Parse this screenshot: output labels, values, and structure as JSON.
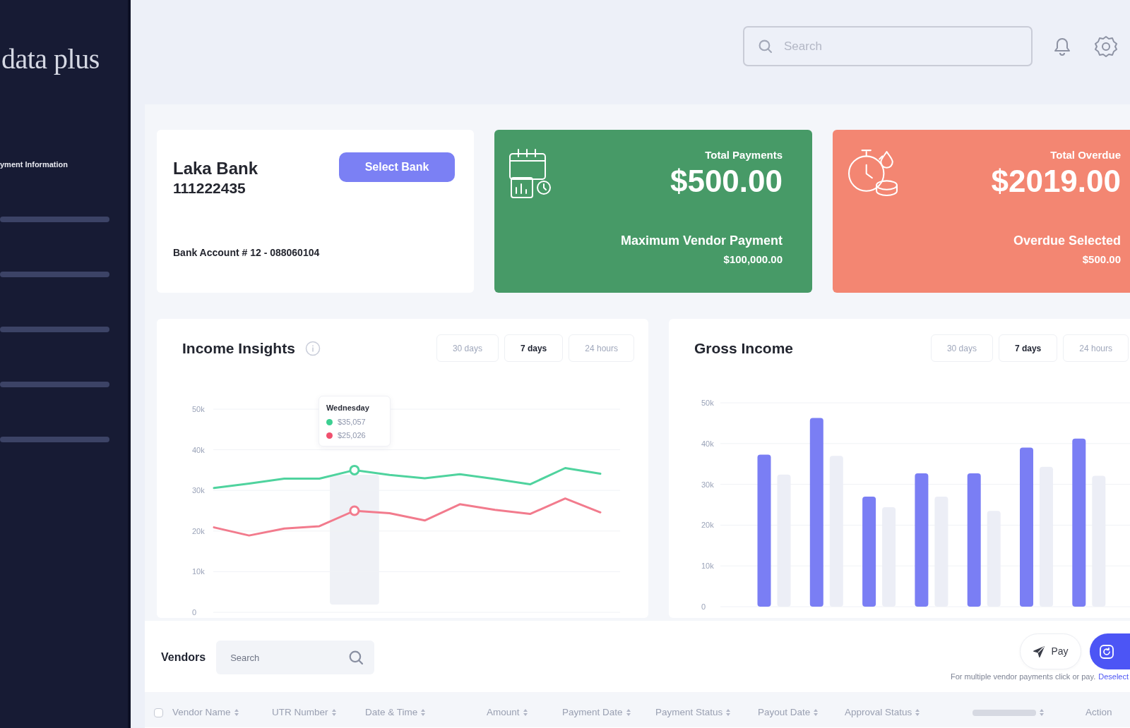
{
  "sidebar": {
    "logo": "data plus",
    "items": [
      {
        "kind": "link",
        "label": "yment Information"
      },
      {
        "kind": "skeleton"
      },
      {
        "kind": "skeleton"
      },
      {
        "kind": "skeleton"
      },
      {
        "kind": "skeleton"
      },
      {
        "kind": "skeleton"
      }
    ]
  },
  "header": {
    "search": {
      "placeholder": "Search"
    }
  },
  "bank_card": {
    "name": "Laka Bank",
    "number": "111222435",
    "button": "Select Bank",
    "account": "Bank Account # 12 - 088060104"
  },
  "stat_cards": [
    {
      "kind": "payments",
      "title": "Total Payments",
      "amount": "$500.00",
      "caption": "Maximum Vendor Payment",
      "caption_value": "$100,000.00",
      "color": "#479a67"
    },
    {
      "kind": "overdue",
      "title": "Total Overdue",
      "amount": "$2019.00",
      "caption": "Overdue Selected",
      "caption_value": "$500.00",
      "color": "#f38672"
    }
  ],
  "income_insights": {
    "title": "Income Insights",
    "range_tabs": [
      {
        "label": "30 days",
        "selected": false
      },
      {
        "label": "7 days",
        "selected": true
      },
      {
        "label": "24 hours",
        "selected": false
      }
    ],
    "tooltip": {
      "title": "Wednesday",
      "entries": [
        {
          "color": "#3ccf91",
          "value": "$35,057"
        },
        {
          "color": "#f0506e",
          "value": "$25,026"
        }
      ]
    },
    "chart_data": [
      {
        "type": "line",
        "categories": [
          null,
          null,
          null,
          null,
          null,
          null,
          null,
          null,
          null,
          null,
          null,
          null
        ],
        "series": [
          {
            "color": "#4fd39e",
            "values": [
              30600,
              31700,
              32900,
              32900,
              35000,
              33800,
              33000,
              34000,
              32800,
              31500,
              35500,
              34100
            ]
          },
          {
            "color": "#f27b8d",
            "values": [
              20900,
              18900,
              20600,
              21200,
              25000,
              24400,
              22600,
              26600,
              25200,
              24200,
              28000,
              24600
            ]
          }
        ],
        "ylim": [
          0,
          50000
        ],
        "yticks": [
          {
            "value": 0,
            "label": "0"
          },
          {
            "value": 10000,
            "label": "10k"
          },
          {
            "value": 20000,
            "label": "20k"
          },
          {
            "value": 30000,
            "label": "30k"
          },
          {
            "value": 40000,
            "label": "40k"
          },
          {
            "value": 50000,
            "label": "50k"
          }
        ],
        "grid": true
      }
    ]
  },
  "gross_income": {
    "title": "Gross Income",
    "range_tabs": [
      {
        "label": "30 days",
        "selected": false
      },
      {
        "label": "7 days",
        "selected": true
      },
      {
        "label": "24 hours",
        "selected": false
      }
    ],
    "chart_data": [
      {
        "type": "bar",
        "categories": [
          null,
          null,
          null,
          null,
          null,
          null,
          null
        ],
        "series": [
          {
            "color": "#7a7ef4",
            "values": [
              37300,
              46300,
              27000,
              32700,
              32700,
              39000,
              41200
            ]
          },
          {
            "color": "#eceef6",
            "values": [
              32400,
              37000,
              24400,
              27000,
              23500,
              34300,
              32100
            ]
          }
        ],
        "ylim": [
          0,
          50000
        ],
        "yticks": [
          {
            "value": 0,
            "label": "0"
          },
          {
            "value": 10000,
            "label": "10k"
          },
          {
            "value": 20000,
            "label": "20k"
          },
          {
            "value": 30000,
            "label": "30k"
          },
          {
            "value": 40000,
            "label": "40k"
          },
          {
            "value": 50000,
            "label": "50k"
          }
        ],
        "grid": true
      }
    ]
  },
  "vendors": {
    "title": "Vendors",
    "search": {
      "placeholder": "Search"
    },
    "buttons": [
      {
        "kind": "outline",
        "label": "Pay"
      },
      {
        "kind": "primary"
      }
    ],
    "note": "For multiple vendor payments click or pay.",
    "note_link": "Deselect",
    "table": {
      "select_all": {
        "checked": false
      },
      "columns": [
        {
          "kind": "text",
          "label": "Vendor Name",
          "sortable": true
        },
        {
          "kind": "text",
          "label": "UTR Number",
          "sortable": true
        },
        {
          "kind": "text",
          "label": "Date & Time",
          "sortable": true
        },
        {
          "kind": "text",
          "label": "Amount",
          "sortable": true
        },
        {
          "kind": "text",
          "label": "Payment Date",
          "sortable": true
        },
        {
          "kind": "text",
          "label": "Payment Status",
          "sortable": true
        },
        {
          "kind": "text",
          "label": "Payout Date",
          "sortable": true
        },
        {
          "kind": "text",
          "label": "Approval Status",
          "sortable": true
        },
        {
          "kind": "redacted",
          "sortable": true
        },
        {
          "kind": "text",
          "label": "Action",
          "sortable": false
        }
      ]
    }
  }
}
